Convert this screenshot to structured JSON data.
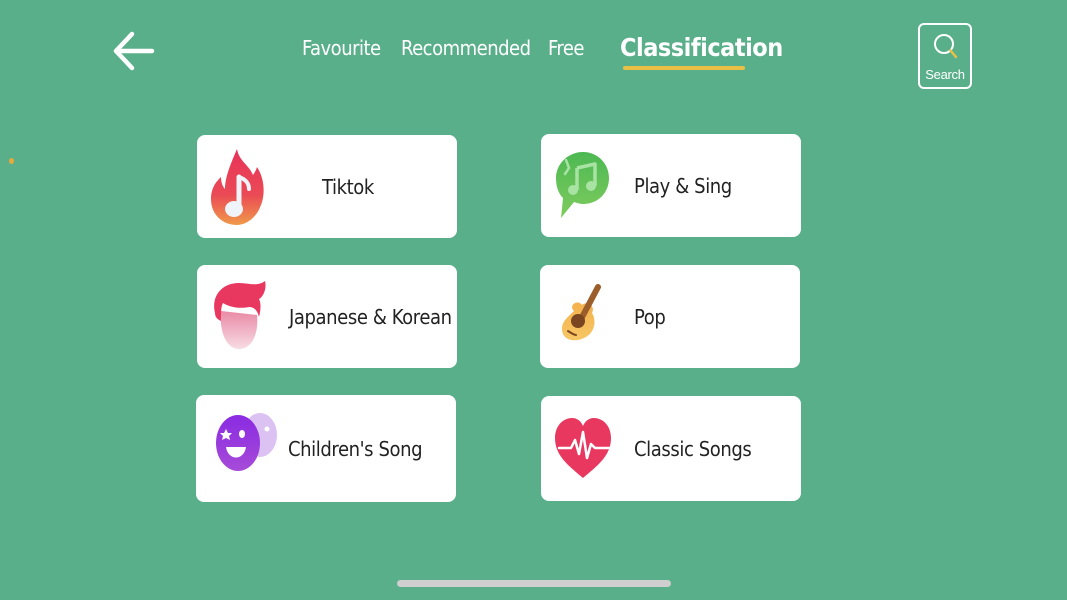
{
  "header": {
    "back_label": "Back",
    "tabs": [
      {
        "label": "Favourite",
        "active": false
      },
      {
        "label": "Recommended",
        "active": false
      },
      {
        "label": "Free",
        "active": false
      },
      {
        "label": "Classification",
        "active": true
      }
    ],
    "search_label": "Search"
  },
  "categories": [
    {
      "label": "Tiktok",
      "icon": "flame-music-icon"
    },
    {
      "label": "Play & Sing",
      "icon": "music-chat-bubble-icon"
    },
    {
      "label": "Japanese & Korean",
      "icon": "hair-person-icon"
    },
    {
      "label": "Pop",
      "icon": "guitar-icon"
    },
    {
      "label": "Children's Song",
      "icon": "smiley-faces-icon"
    },
    {
      "label": "Classic Songs",
      "icon": "heartbeat-icon"
    }
  ],
  "colors": {
    "background": "#5aaf8b",
    "accent_underline": "#e9bf45",
    "card": "#ffffff"
  }
}
